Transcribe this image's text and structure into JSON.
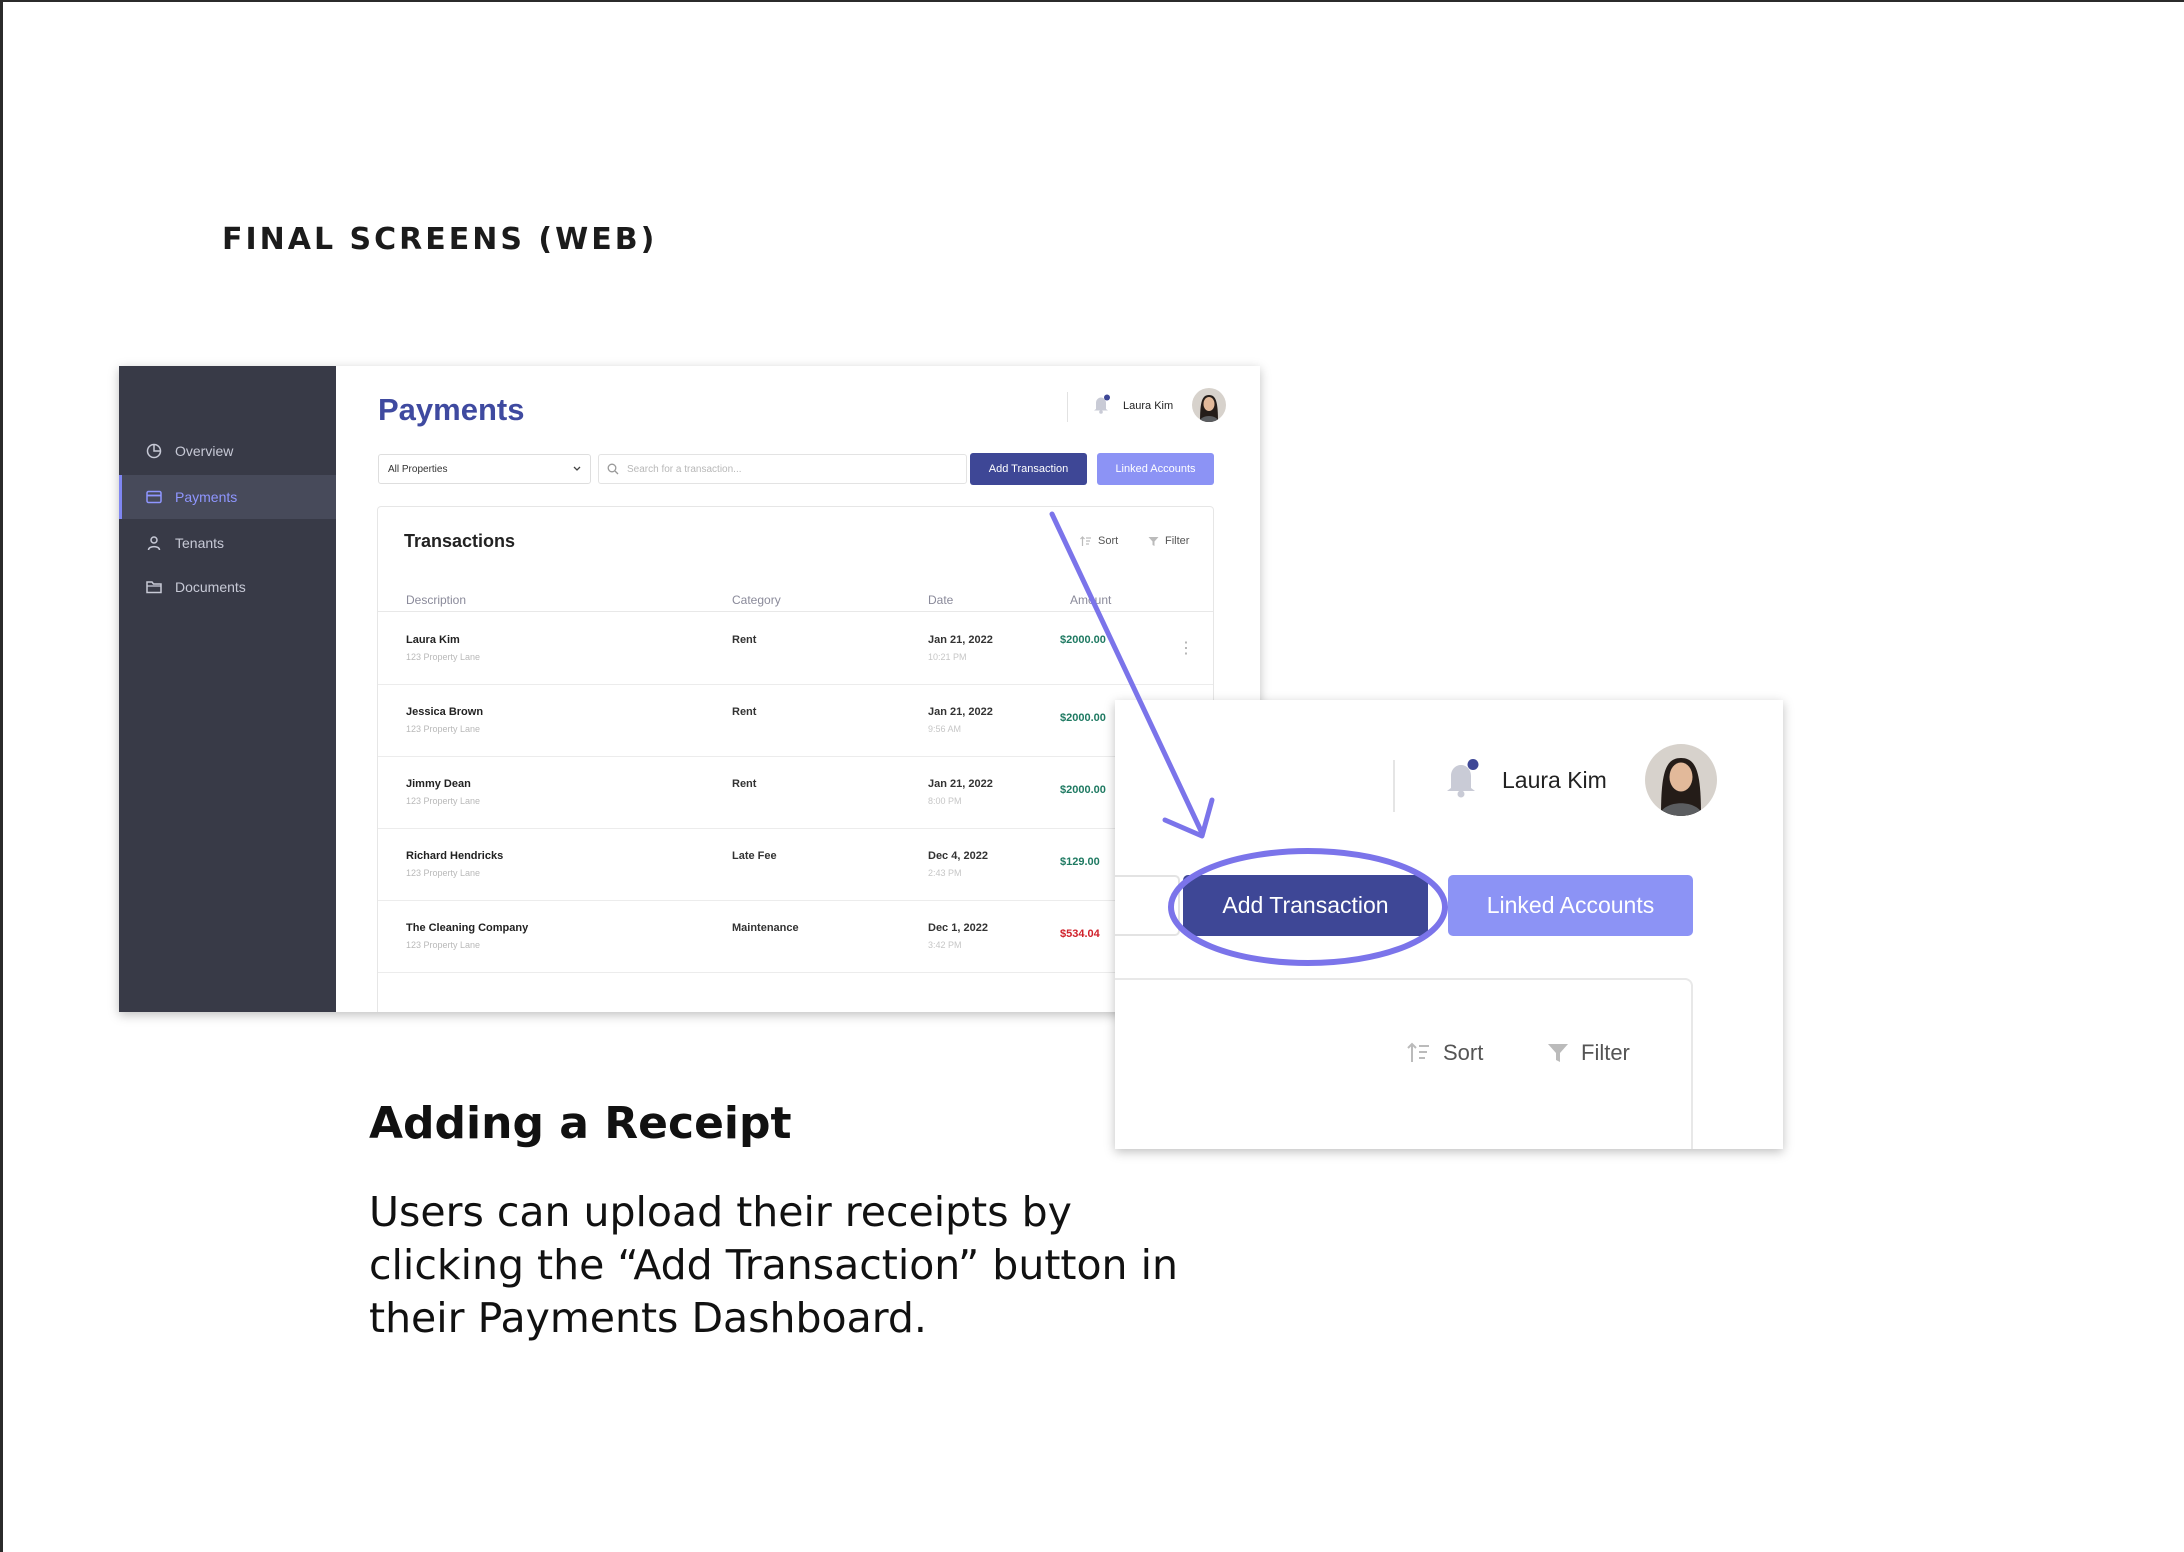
{
  "section_title": "FINAL SCREENS (WEB)",
  "app": {
    "page_title": "Payments",
    "user_name": "Laura Kim",
    "sidebar": {
      "items": [
        {
          "label": "Overview",
          "icon": "pie-chart-icon",
          "active": false
        },
        {
          "label": "Payments",
          "icon": "card-icon",
          "active": true
        },
        {
          "label": "Tenants",
          "icon": "person-icon",
          "active": false
        },
        {
          "label": "Documents",
          "icon": "folder-icon",
          "active": false
        }
      ]
    },
    "property_select": {
      "value": "All Properties"
    },
    "search": {
      "placeholder": "Search for a transaction..."
    },
    "buttons": {
      "add_transaction": "Add Transaction",
      "linked_accounts": "Linked Accounts"
    },
    "transactions": {
      "title": "Transactions",
      "sort_label": "Sort",
      "filter_label": "Filter",
      "columns": [
        "Description",
        "Category",
        "Date",
        "Amount"
      ],
      "rows": [
        {
          "name": "Laura Kim",
          "address": "123 Property Lane",
          "category": "Rent",
          "date": "Jan 21, 2022",
          "time": "10:21 PM",
          "amount": "$2000.00",
          "negative": false
        },
        {
          "name": "Jessica Brown",
          "address": "123 Property Lane",
          "category": "Rent",
          "date": "Jan 21, 2022",
          "time": "9:56 AM",
          "amount": "$2000.00",
          "negative": false
        },
        {
          "name": "Jimmy Dean",
          "address": "123 Property Lane",
          "category": "Rent",
          "date": "Jan 21, 2022",
          "time": "8:00 PM",
          "amount": "$2000.00",
          "negative": false
        },
        {
          "name": "Richard Hendricks",
          "address": "123 Property Lane",
          "category": "Late Fee",
          "date": "Dec 4, 2022",
          "time": "2:43 PM",
          "amount": "$129.00",
          "negative": false
        },
        {
          "name": "The Cleaning Company",
          "address": "123 Property Lane",
          "category": "Maintenance",
          "date": "Dec 1, 2022",
          "time": "3:42 PM",
          "amount": "$534.04",
          "negative": true
        }
      ]
    }
  },
  "zoom": {
    "user_name": "Laura Kim",
    "add_transaction": "Add Transaction",
    "linked_accounts": "Linked Accounts",
    "sort_label": "Sort",
    "filter_label": "Filter"
  },
  "caption": {
    "title": "Adding a Receipt",
    "body_line1": "Users can upload their receipts by",
    "body_line2": "clicking the “Add Transaction” button in",
    "body_line3": "their Payments Dashboard."
  },
  "colors": {
    "sidebar_bg": "#383a47",
    "primary": "#3e4796",
    "secondary": "#8c93f5",
    "annotation": "#7b74ea",
    "positive_amount": "#1f7a62",
    "negative_amount": "#d0212b"
  }
}
